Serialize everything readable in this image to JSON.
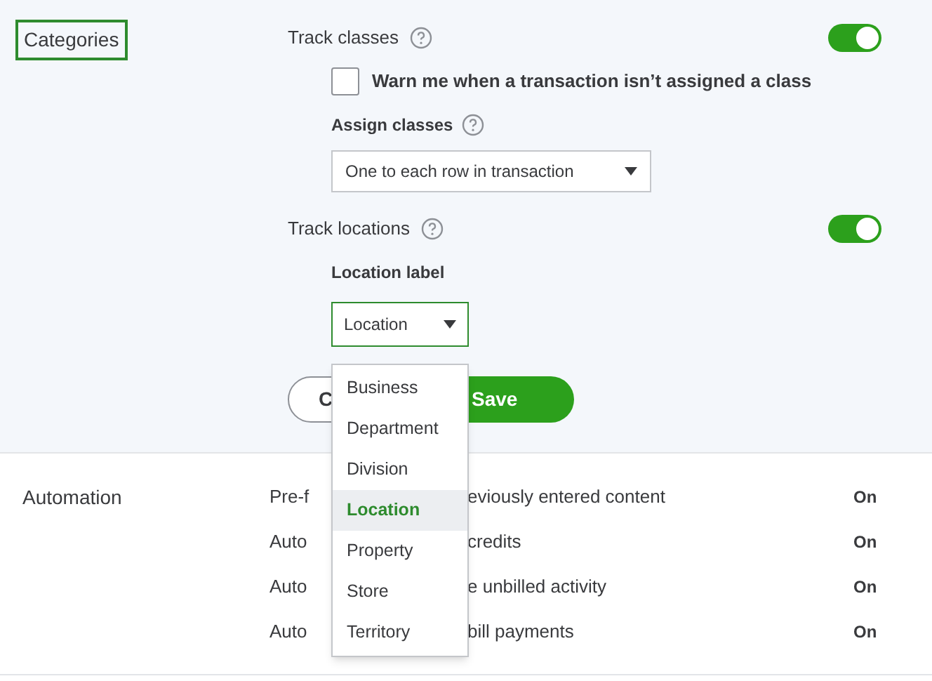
{
  "categories": {
    "label": "Categories",
    "highlighted": true,
    "track_classes": {
      "label": "Track classes",
      "on": true
    },
    "warn_checkbox": {
      "label": "Warn me when a transaction isn’t assigned a class",
      "checked": false
    },
    "assign_classes": {
      "label": "Assign classes",
      "value": "One to each row in transaction"
    },
    "track_locations": {
      "label": "Track locations",
      "on": true
    },
    "location_label": {
      "label": "Location label",
      "value": "Location"
    },
    "cancel_button": "C",
    "save_button": "Save",
    "dropdown_options": [
      {
        "label": "Business",
        "selected": false
      },
      {
        "label": "Department",
        "selected": false
      },
      {
        "label": "Division",
        "selected": false
      },
      {
        "label": "Location",
        "selected": true
      },
      {
        "label": "Property",
        "selected": false
      },
      {
        "label": "Store",
        "selected": false
      },
      {
        "label": "Territory",
        "selected": false
      }
    ]
  },
  "automation": {
    "label": "Automation",
    "rows": [
      {
        "lead": "Pre-f",
        "tail": "eviously entered content",
        "value": "On"
      },
      {
        "lead": "Auto",
        "tail": "credits",
        "value": "On"
      },
      {
        "lead": "Auto",
        "tail": "e unbilled activity",
        "value": "On"
      },
      {
        "lead": "Auto",
        "tail": "bill payments",
        "value": "On"
      }
    ]
  }
}
